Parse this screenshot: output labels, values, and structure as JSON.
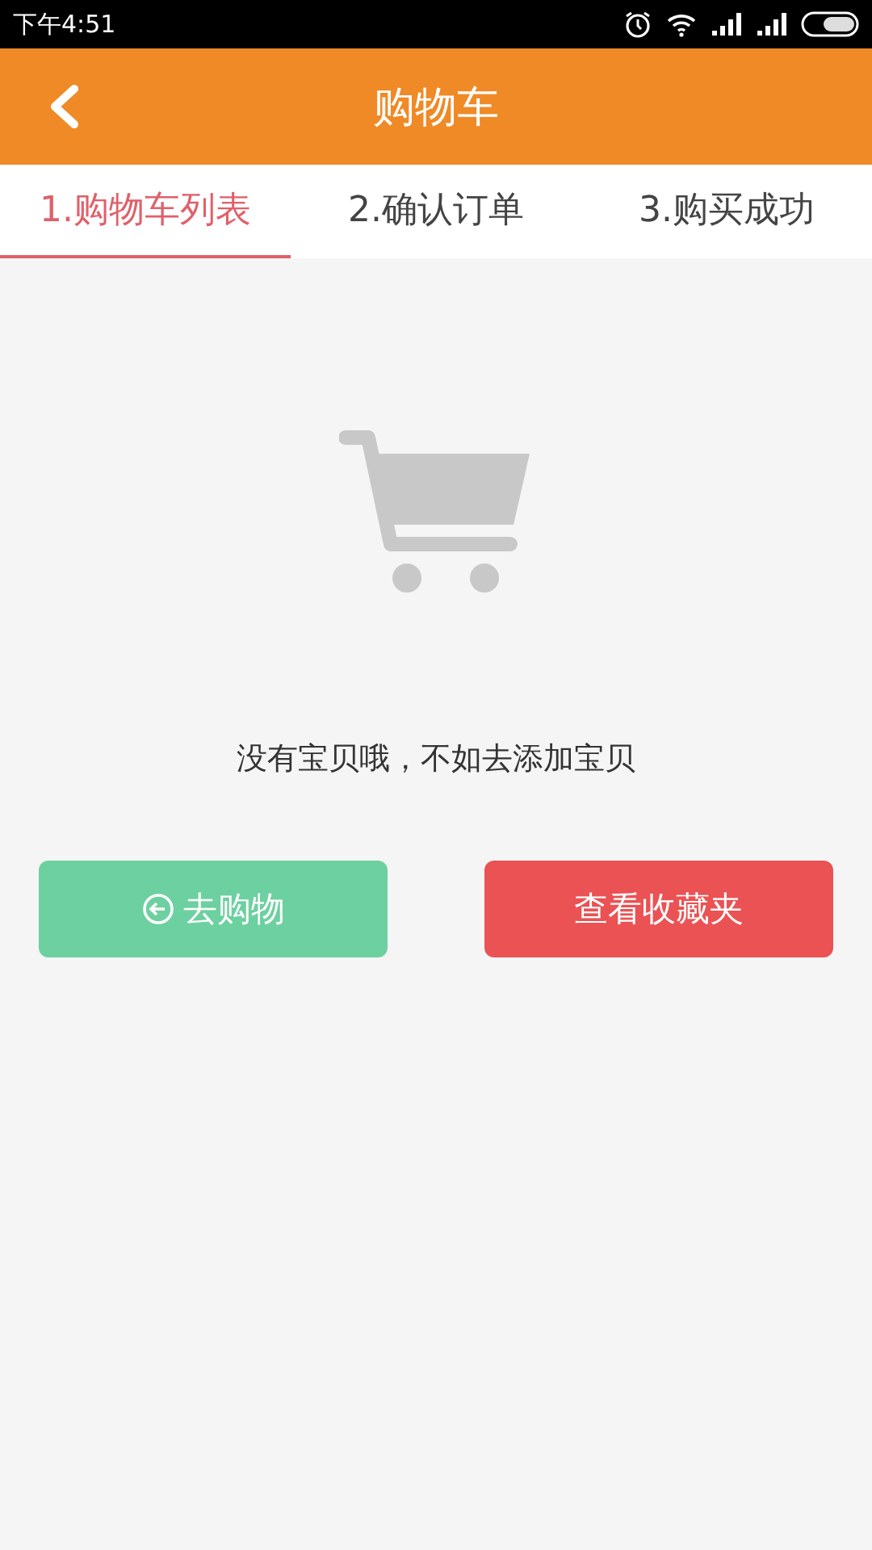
{
  "status_bar": {
    "time": "下午4:51"
  },
  "header": {
    "title": "购物车"
  },
  "tabs": [
    {
      "label": "1.购物车列表",
      "selected": true
    },
    {
      "label": "2.确认订单",
      "selected": false
    },
    {
      "label": "3.购买成功",
      "selected": false
    }
  ],
  "empty_state": {
    "message": "没有宝贝哦，不如去添加宝贝"
  },
  "buttons": [
    {
      "kind": "shop",
      "label": "去购物"
    },
    {
      "kind": "favorites",
      "label": "查看收藏夹"
    }
  ]
}
